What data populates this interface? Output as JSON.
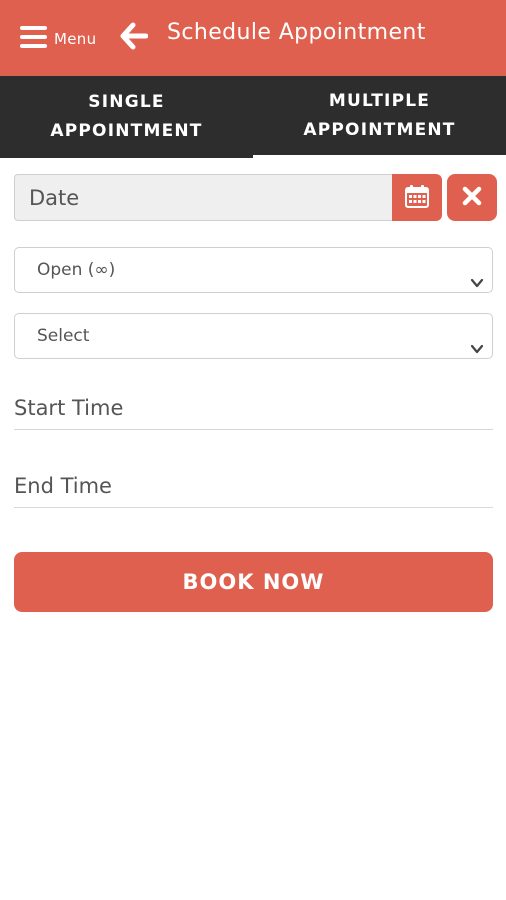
{
  "header": {
    "menu_label": "Menu",
    "title": "Schedule Appointment",
    "accent_color": "#e0604f",
    "menu_icon": "hamburger-icon",
    "back_icon": "arrow-left-icon"
  },
  "tabs": [
    {
      "label": "SINGLE APPOINTMENT",
      "active": true
    },
    {
      "label": "MULTIPLE APPOINTMENT",
      "active": false
    }
  ],
  "form": {
    "date_placeholder": "Date",
    "calendar_icon": "calendar-icon",
    "clear_icon": "close-icon",
    "availability_selected": "Open (∞)",
    "select_placeholder": "Select",
    "start_time_placeholder": "Start Time",
    "end_time_placeholder": "End Time"
  },
  "actions": {
    "book_label": "BOOK NOW"
  }
}
